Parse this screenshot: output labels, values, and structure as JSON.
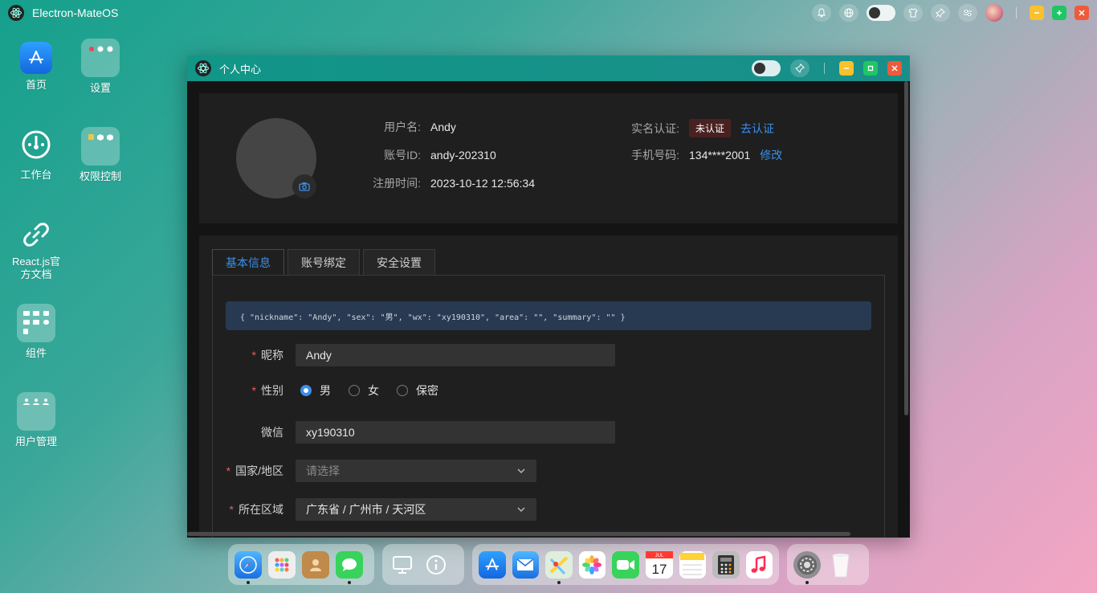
{
  "topbar": {
    "title": "Electron-MateOS"
  },
  "desktop": {
    "icons": [
      {
        "label": "首页"
      },
      {
        "label": "设置"
      },
      {
        "label": "工作台"
      },
      {
        "label": "权限控制"
      },
      {
        "label": "React.js官方文档"
      },
      {
        "label": "组件"
      },
      {
        "label": "用户管理"
      }
    ]
  },
  "window": {
    "title": "个人中心",
    "profile": {
      "username_label": "用户名:",
      "username": "Andy",
      "account_id_label": "账号ID:",
      "account_id": "andy-202310",
      "register_label": "注册时间:",
      "register_time": "2023-10-12 12:56:34",
      "realname_label": "实名认证:",
      "realname_status": "未认证",
      "realname_action": "去认证",
      "phone_label": "手机号码:",
      "phone": "134****2001",
      "phone_action": "修改"
    },
    "tabs": [
      {
        "label": "基本信息"
      },
      {
        "label": "账号绑定"
      },
      {
        "label": "安全设置"
      }
    ],
    "json_preview": "{ \"nickname\": \"Andy\", \"sex\": \"男\", \"wx\": \"xy190310\", \"area\": \"\", \"summary\": \"\" }",
    "form": {
      "nickname_label": "昵称",
      "nickname": "Andy",
      "sex_label": "性别",
      "sex_options": [
        "男",
        "女",
        "保密"
      ],
      "wechat_label": "微信",
      "wechat": "xy190310",
      "country_label": "国家/地区",
      "country_placeholder": "请选择",
      "area_label": "所在区域",
      "area": "广东省 / 广州市 / 天河区"
    }
  },
  "colors": {
    "accent": "#3b8fe8",
    "required": "#f05a5a",
    "titlebar": "#119688"
  }
}
